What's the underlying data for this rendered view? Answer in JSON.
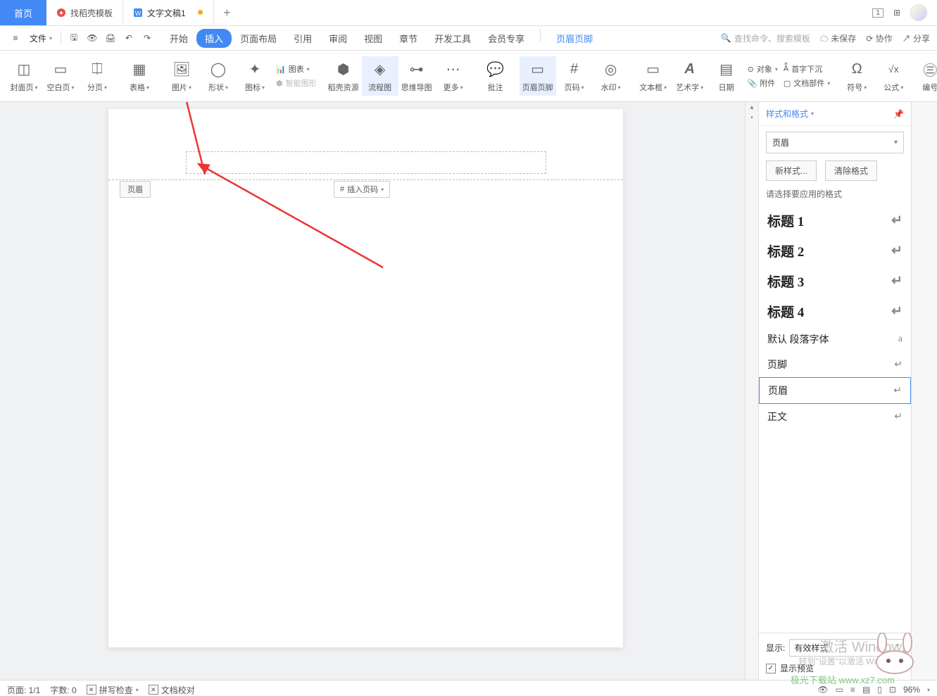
{
  "tabs": {
    "home": "首页",
    "templates": "找稻壳模板",
    "doc": "文字文稿1"
  },
  "menubar": {
    "file": "文件",
    "items": [
      "开始",
      "插入",
      "页面布局",
      "引用",
      "审阅",
      "视图",
      "章节",
      "开发工具",
      "会员专享"
    ],
    "active_index": 1,
    "special": "页眉页脚",
    "search_hint": "查找命令、搜索模板",
    "unsaved": "未保存",
    "collab": "协作",
    "share": "分享"
  },
  "ribbon": {
    "items": [
      {
        "label": "封面页",
        "icon": "◫"
      },
      {
        "label": "空白页",
        "icon": "▭"
      },
      {
        "label": "分页",
        "icon": "⎅"
      },
      {
        "label": "表格",
        "icon": "▦"
      },
      {
        "label": "图片",
        "icon": "▲"
      },
      {
        "label": "形状",
        "icon": "◯"
      },
      {
        "label": "图标",
        "icon": "✦"
      }
    ],
    "smart": {
      "chart": "图表",
      "smartart": "智能图形"
    },
    "items2": [
      {
        "label": "稻壳资源",
        "icon": "⬢"
      },
      {
        "label": "流程图",
        "icon": "◈",
        "active": true
      },
      {
        "label": "思维导图",
        "icon": "⊶"
      },
      {
        "label": "更多",
        "icon": "⋯"
      },
      {
        "label": "批注",
        "icon": "▭"
      },
      {
        "label": "页眉页脚",
        "icon": "▭",
        "active": true
      },
      {
        "label": "页码",
        "icon": "#"
      },
      {
        "label": "水印",
        "icon": "◎"
      },
      {
        "label": "文本框",
        "icon": "▭"
      },
      {
        "label": "艺术字",
        "icon": "A"
      },
      {
        "label": "日期",
        "icon": "▤"
      }
    ],
    "side": {
      "object": "对象",
      "firstcap": "首字下沉",
      "attachment": "附件",
      "docparts": "文档部件"
    },
    "items3": [
      {
        "label": "符号",
        "icon": "Ω"
      },
      {
        "label": "公式",
        "icon": "√x"
      },
      {
        "label": "编号",
        "icon": "㊂"
      }
    ]
  },
  "canvas": {
    "header_label": "页眉",
    "insert_pagenumber": "插入页码"
  },
  "panel": {
    "title": "样式和格式",
    "current_style": "页眉",
    "new_style": "新样式...",
    "clear_format": "清除格式",
    "prompt": "请选择要应用的格式",
    "styles": [
      {
        "label": "标题 1",
        "cls": "h"
      },
      {
        "label": "标题 2",
        "cls": "h"
      },
      {
        "label": "标题 3",
        "cls": "h"
      },
      {
        "label": "标题 4",
        "cls": "h"
      },
      {
        "label": "默认 段落字体",
        "cls": "normal",
        "ret": "a"
      },
      {
        "label": "页脚",
        "cls": "normal"
      },
      {
        "label": "页眉",
        "cls": "normal",
        "selected": true
      },
      {
        "label": "正文",
        "cls": "normal"
      }
    ],
    "show": "显示:",
    "show_value": "有效样式",
    "preview": "显示预览"
  },
  "status": {
    "page": "页面: 1/1",
    "words": "字数: 0",
    "spell": "拼写检查",
    "proof": "文档校对",
    "zoom": "96%"
  },
  "overlay": {
    "activate_title": "激活 Windows",
    "activate_sub": "转到\"设置\"以激活 Windows。",
    "watermark": "极光下载站  www.xz7.com"
  }
}
